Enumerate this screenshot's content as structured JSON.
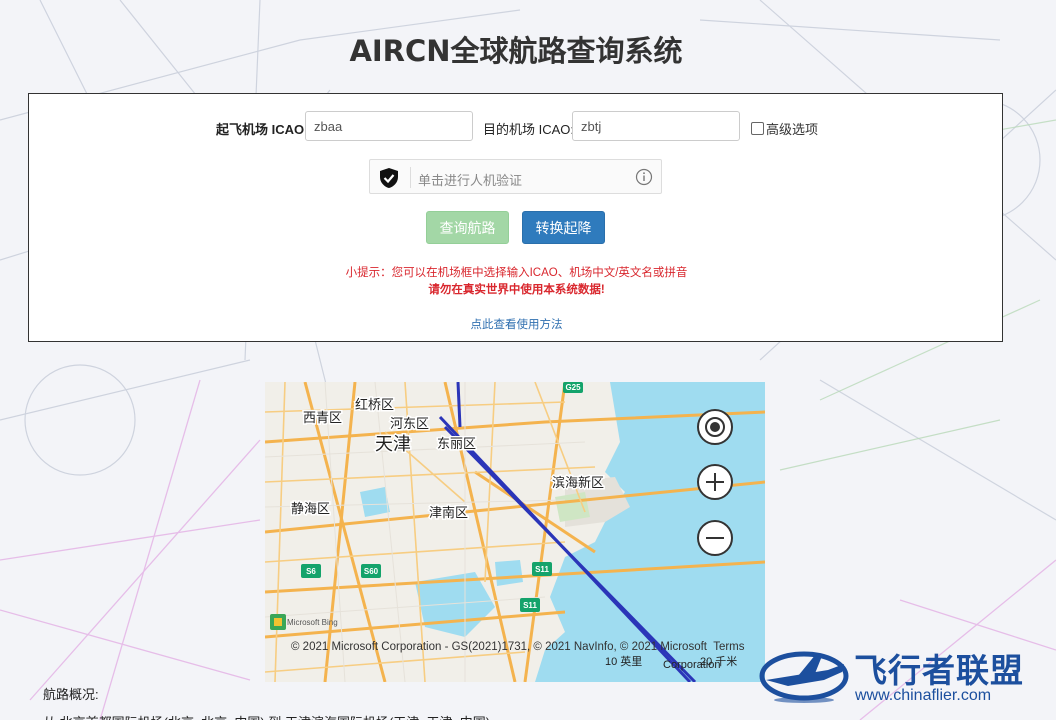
{
  "page": {
    "title": "AIRCN全球航路查询系统"
  },
  "form": {
    "departure_label": "起飞机场 ICAO:",
    "departure_value": "zbaa",
    "arrival_label": "目的机场 ICAO:",
    "arrival_value": "zbtj",
    "advanced_label": "高级选项",
    "advanced_checked": false,
    "captcha_text": "单击进行人机验证",
    "query_button": "查询航路",
    "swap_button": "转换起降",
    "tip_line1": "小提示：您可以在机场框中选择输入ICAO、机场中文/英文名或拼音",
    "tip_line2": "请勿在真实世界中使用本系统数据!",
    "howto_link": "点此查看使用方法"
  },
  "map": {
    "labels": {
      "xiqing": "西青区",
      "hongqiao": "红桥区",
      "hedong": "河东区",
      "tianjin": "天津",
      "dongli": "东丽区",
      "binhai": "滨海新区",
      "jinghai": "静海区",
      "jinnan": "津南区"
    },
    "shields": {
      "g25": "G25",
      "s": "S6",
      "s60": "S60",
      "s11a": "S11",
      "s11b": "S11"
    },
    "bing_label": "Microsoft Bing",
    "copyright": "© 2021 Microsoft Corporation - GS(2021)1731, © 2021 NavInfo, © 2021 Microsoft",
    "terms": "Terms",
    "scale_km": "10 英里",
    "scale_mi": "20 千米",
    "corp": "Corporation",
    "controls": [
      "locate-icon",
      "zoom-in-icon",
      "zoom-out-icon"
    ]
  },
  "route": {
    "section_label": "航路概况:",
    "summary_line": "从 北京首都国际机场(北京, 北京, 中国) 到 天津滨海国际机场(天津, 天津, 中国)"
  },
  "watermark": {
    "title": "飞行者联盟",
    "url": "www.chinaflier.com"
  },
  "colors": {
    "route_line": "#2b35b8",
    "sea": "#9fdcf0",
    "swap_button": "#2f7bbd",
    "query_button": "#a3d7a6",
    "tip": "#d9272e",
    "watermark": "#1c4f9e"
  }
}
